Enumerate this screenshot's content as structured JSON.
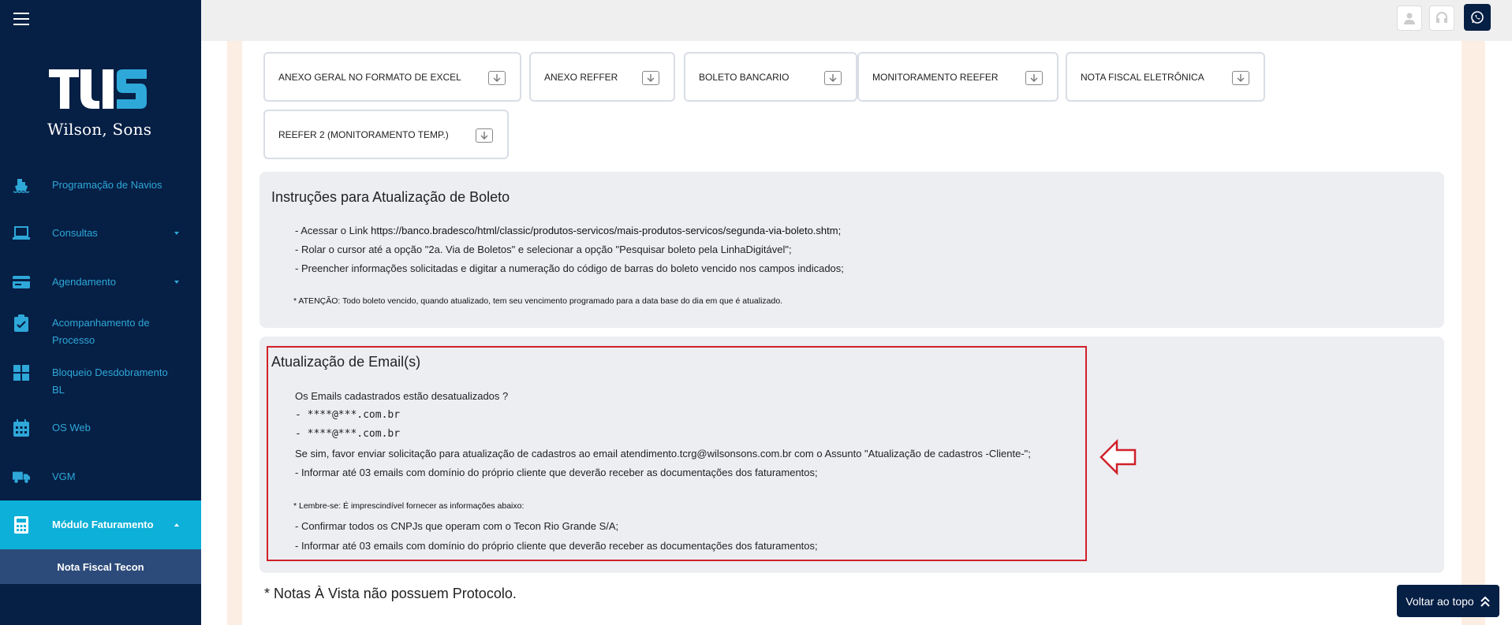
{
  "brand": {
    "name": "Wilson, Sons"
  },
  "sidebar": {
    "items": [
      {
        "label": "Programação de Navios",
        "icon": "ship-icon"
      },
      {
        "label": "Consultas",
        "icon": "laptop-icon"
      },
      {
        "label": "Agendamento",
        "icon": "card-icon"
      },
      {
        "label": "Acompanhamento de Processo",
        "icon": "clipboard-check-icon"
      },
      {
        "label": "Bloqueio Desdobramento BL",
        "icon": "grid-icon"
      },
      {
        "label": "OS Web",
        "icon": "calendar-icon"
      },
      {
        "label": "VGM",
        "icon": "truck-icon"
      },
      {
        "label": "Módulo Faturamento",
        "icon": "calculator-icon"
      }
    ],
    "sub_item": "Nota Fiscal Tecon"
  },
  "downloads": [
    "ANEXO GERAL NO FORMATO DE EXCEL",
    "ANEXO REFFER",
    "BOLETO BANCARIO",
    "MONITORAMENTO REEFER",
    "NOTA FISCAL ELETRÔNICA",
    "REEFER 2 (MONITORAMENTO TEMP.)"
  ],
  "boleto": {
    "title": "Instruções para Atualização de Boleto",
    "line1_prefix": "- Acessar o Link ",
    "line1_link": "https://banco.bradesco/html/classic/produtos-servicos/mais-produtos-servicos/segunda-via-boleto.shtm;",
    "line2": "- Rolar o cursor até a opção \"2a. Via de Boletos\" e selecionar a opção \"Pesquisar boleto pela LinhaDigitável\";",
    "line3": "- Preencher informações solicitadas e digitar a numeração do código de barras do boleto vencido nos campos indicados;",
    "note": "* ATENÇÃO: Todo boleto vencido, quando atualizado, tem seu vencimento programado para a data base do dia em que é atualizado."
  },
  "email": {
    "title": "Atualização de Email(s)",
    "question": "Os Emails cadastrados estão desatualizados ?",
    "email1": "- ****@***.com.br",
    "email2": "- ****@***.com.br",
    "instruction": "Se sim, favor enviar solicitação para atualização de cadastros ao email atendimento.tcrg@wilsonsons.com.br com o Assunto \"Atualização de cadastros -Cliente-\";",
    "inform1": "- Informar até 03 emails com domínio do próprio cliente que deverão receber as documentações dos faturamentos;",
    "reminder": "* Lembre-se: É imprescindível fornecer as informações abaixo:",
    "confirm": "- Confirmar todos os CNPJs que operam com o Tecon Rio Grande S/A;",
    "inform2": "- Informar até 03 emails com domínio do próprio cliente que deverão receber as documentações dos faturamentos;"
  },
  "footer_note": "* Notas À Vista não possuem Protocolo.",
  "back_to_top": "Voltar ao topo",
  "colors": {
    "sidebar": "#061f45",
    "accent": "#0db0d8",
    "highlight": "#d0202a"
  }
}
